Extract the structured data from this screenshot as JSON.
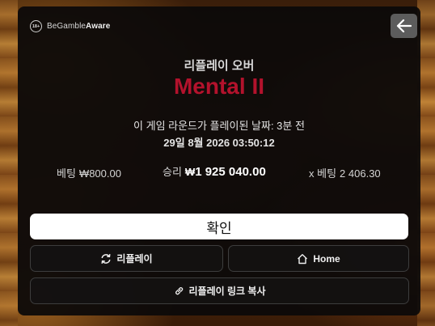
{
  "header": {
    "gamble_aware_badge": "18+",
    "gamble_aware_prefix": "BeGamble",
    "gamble_aware_suffix": "Aware",
    "back_icon": "arrow-left-icon"
  },
  "replay": {
    "subtitle": "리플레이 오버",
    "game_title": "Mental II",
    "played_text": "이 게임 라운드가 플레이된 날짜: 3분 전",
    "datetime": "29일 8월 2026 03:50:12"
  },
  "stats": {
    "bet_label": "베팅",
    "bet_value": "₩800.00",
    "win_label": "승리",
    "win_currency": "₩",
    "win_value": "1 925 040.00",
    "multiplier_label": "x 베팅",
    "multiplier_value": "2 406.30"
  },
  "actions": {
    "confirm_label": "확인",
    "replay_label": "리플레이",
    "replay_icon": "refresh-icon",
    "home_label": "Home",
    "home_icon": "home-icon",
    "copy_label": "리플레이 링크 복사",
    "copy_icon": "link-icon"
  },
  "colors": {
    "title": "#b3122c",
    "modal_bg": "#0c0a0a",
    "confirm_bg": "#ffffff"
  }
}
